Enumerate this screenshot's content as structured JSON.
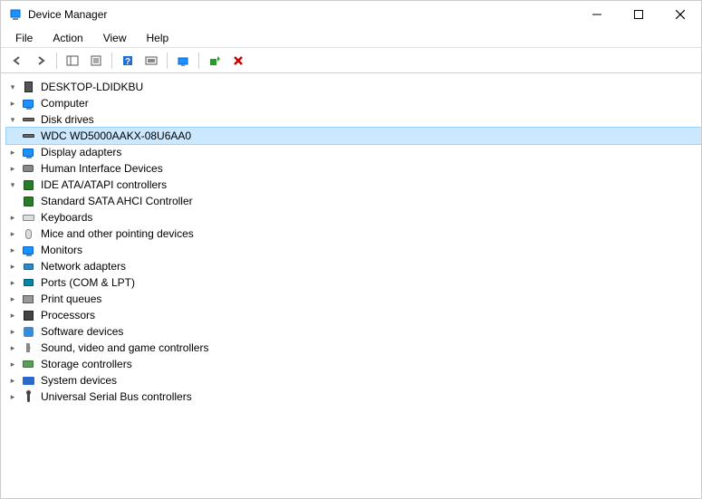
{
  "window": {
    "title": "Device Manager"
  },
  "menu": {
    "file": "File",
    "action": "Action",
    "view": "View",
    "help": "Help"
  },
  "tree": {
    "root": "DESKTOP-LDIDKBU",
    "computer": "Computer",
    "disk_drives": {
      "label": "Disk drives",
      "child_wdc": "WDC WD5000AAKX-08U6AA0"
    },
    "display_adapters": "Display adapters",
    "hid": "Human Interface Devices",
    "ide": {
      "label": "IDE ATA/ATAPI controllers",
      "child_sata": "Standard SATA AHCI Controller"
    },
    "keyboards": "Keyboards",
    "mice": "Mice and other pointing devices",
    "monitors": "Monitors",
    "network": "Network adapters",
    "ports": "Ports (COM & LPT)",
    "print_queues": "Print queues",
    "processors": "Processors",
    "software_devices": "Software devices",
    "sound": "Sound, video and game controllers",
    "storage_ctrl": "Storage controllers",
    "system_devices": "System devices",
    "usb": "Universal Serial Bus controllers"
  }
}
